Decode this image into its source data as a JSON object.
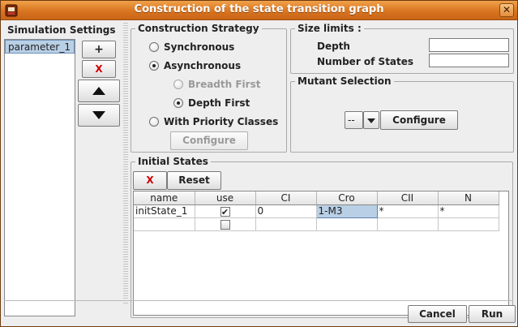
{
  "window": {
    "title": "Construction of the state transition graph",
    "close_glyph": "✕"
  },
  "settings": {
    "title": "Simulation Settings",
    "items": [
      "parameter_1"
    ],
    "add_label": "+",
    "remove_label": "X",
    "remove_color": "#d00000"
  },
  "strategy": {
    "title": "Construction Strategy",
    "options": {
      "synchronous": "Synchronous",
      "asynchronous": "Asynchronous",
      "breadth_first": "Breadth First",
      "depth_first": "Depth First",
      "priority": "With Priority Classes"
    },
    "selected": "asynchronous",
    "sub_selected": "depth_first",
    "configure_label": "Configure"
  },
  "size_limits": {
    "title": "Size limits :",
    "depth_label": "Depth",
    "depth_value": "",
    "states_label": "Number of States",
    "states_value": ""
  },
  "mutant": {
    "title": "Mutant Selection",
    "selected": "--",
    "configure_label": "Configure"
  },
  "initial_states": {
    "title": "Initial States",
    "delete_label": "X",
    "reset_label": "Reset",
    "columns": [
      "name",
      "use",
      "CI",
      "Cro",
      "CII",
      "N"
    ],
    "rows": [
      {
        "name": "initState_1",
        "use": true,
        "CI": "0",
        "Cro": "1-M3",
        "CII": "*",
        "N": "*"
      },
      {
        "name": "",
        "use": false,
        "CI": "",
        "Cro": "",
        "CII": "",
        "N": ""
      }
    ]
  },
  "footer": {
    "cancel_label": "Cancel",
    "run_label": "Run"
  },
  "colors": {
    "title_bar": "#d97520",
    "selection": "#b8cfe5"
  }
}
